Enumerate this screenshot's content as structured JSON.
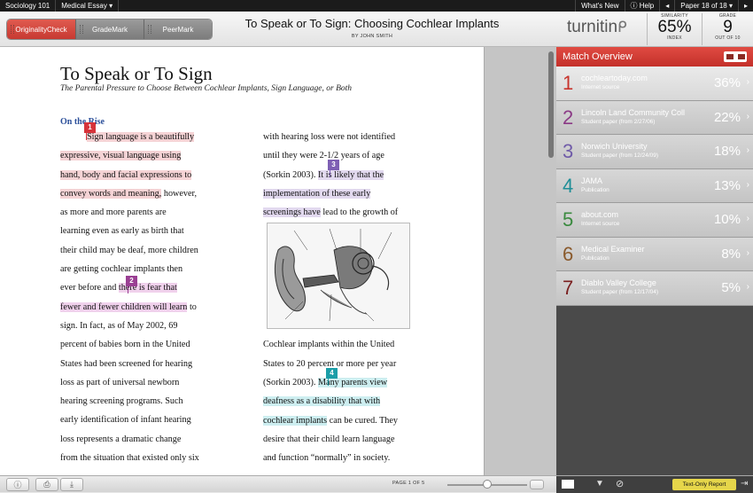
{
  "topbar": {
    "class_name": "Sociology 101",
    "assignment": "Medical Essay",
    "whats_new": "What's New",
    "help": "Help",
    "paper_nav": "Paper 18 of 18"
  },
  "tabs": [
    {
      "label": "OriginalityCheck",
      "active": true
    },
    {
      "label": "GradeMark",
      "active": false
    },
    {
      "label": "PeerMark",
      "active": false
    }
  ],
  "document": {
    "title": "To Speak or To Sign: Choosing Cochlear Implants",
    "author": "BY JOHN SMITH"
  },
  "brand": {
    "logo": "turnitin",
    "accent": "#d2382f"
  },
  "similarity": {
    "label": "SIMILARITY",
    "value": "65%",
    "sub": "INDEX"
  },
  "grade": {
    "label": "GRADE",
    "value": "9",
    "sub": "OUT OF 10"
  },
  "paper": {
    "heading": "To Speak or To Sign",
    "subheading": "The Parental Pressure to Choose Between Cochlear Implants, Sign Language, or Both",
    "section": "On the Rise",
    "col1": [
      "Sign language is a beautifully",
      "expressive, visual language using",
      "hand, body and facial expressions to",
      "convey words and meaning, however,",
      "as more and more parents are",
      "learning even as early as birth that",
      "their child may be deaf, more children",
      "are getting cochlear implants then",
      "ever before and there is fear that",
      "fewer and fewer children will learn to",
      "sign. In fact, as of May 2002, 69",
      "percent of babies born in the United",
      "States had been screened for hearing",
      "loss as part of universal newborn",
      "hearing screening programs. Such",
      "early identification of infant hearing",
      "loss represents a dramatic change",
      "from the situation that existed only six"
    ],
    "col2_top": [
      "with hearing loss were not identified",
      "until they were 2-1/2 years of age",
      "(Sorkin 2003). It is likely that the",
      "implementation of these early",
      "screenings have lead to the growth of"
    ],
    "col2_bottom": [
      "Cochlear implants within the United",
      "States to 20 percent or more per year",
      "(Sorkin 2003). Many parents view",
      "deafness as a disability that with",
      "cochlear implants can be cured. They",
      "desire that their child learn language",
      "and function “normally” in society."
    ],
    "markers": [
      "1",
      "2",
      "3",
      "4"
    ]
  },
  "match_overview": {
    "title": "Match Overview",
    "matches": [
      {
        "index": "1",
        "source": "cochleartoday.com",
        "type": "Internet source",
        "percent": "36%",
        "color": "#c8332c"
      },
      {
        "index": "2",
        "source": "Lincoln Land Community Coll",
        "type": "Student paper (from 2/27/06)",
        "percent": "22%",
        "color": "#8b3a86"
      },
      {
        "index": "3",
        "source": "Norwich University",
        "type": "Student paper (from 12/24/09)",
        "percent": "18%",
        "color": "#6f5aa8"
      },
      {
        "index": "4",
        "source": "JAMA",
        "type": "Publication",
        "percent": "13%",
        "color": "#1f8e97"
      },
      {
        "index": "5",
        "source": "about.com",
        "type": "Internet source",
        "percent": "10%",
        "color": "#3a8a3f"
      },
      {
        "index": "6",
        "source": "Medical Examiner",
        "type": "Publication",
        "percent": "8%",
        "color": "#8a5a2c"
      },
      {
        "index": "7",
        "source": "Diablo Valley College",
        "type": "Student paper (from 12/17/04)",
        "percent": "5%",
        "color": "#7a1f1f"
      }
    ]
  },
  "bottombar": {
    "page_indicator": "PAGE 1 OF 5",
    "text_only": "Text-Only Report",
    "zoom_level": 0.5
  }
}
